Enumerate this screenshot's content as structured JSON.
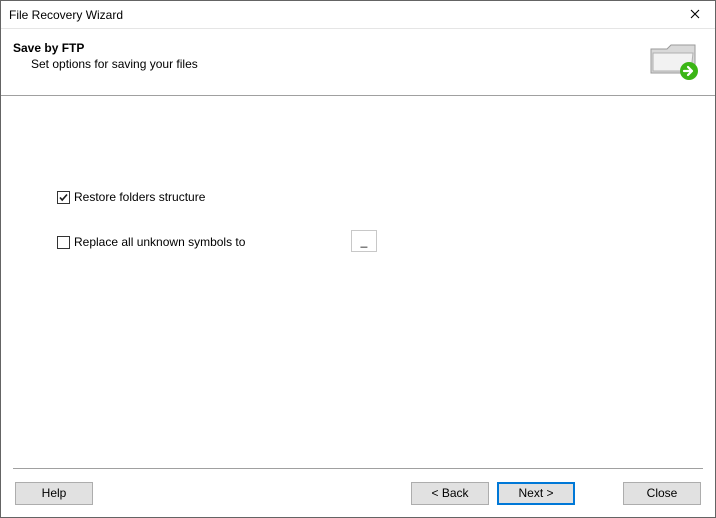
{
  "window": {
    "title": "File Recovery Wizard"
  },
  "banner": {
    "heading": "Save by FTP",
    "subheading": "Set options for saving your files"
  },
  "options": {
    "restore_folders": {
      "label": "Restore folders structure",
      "checked": true
    },
    "replace_unknown": {
      "label": "Replace all unknown symbols to",
      "checked": false,
      "value": "_"
    }
  },
  "buttons": {
    "help": "Help",
    "back": "< Back",
    "next": "Next >",
    "close": "Close"
  }
}
